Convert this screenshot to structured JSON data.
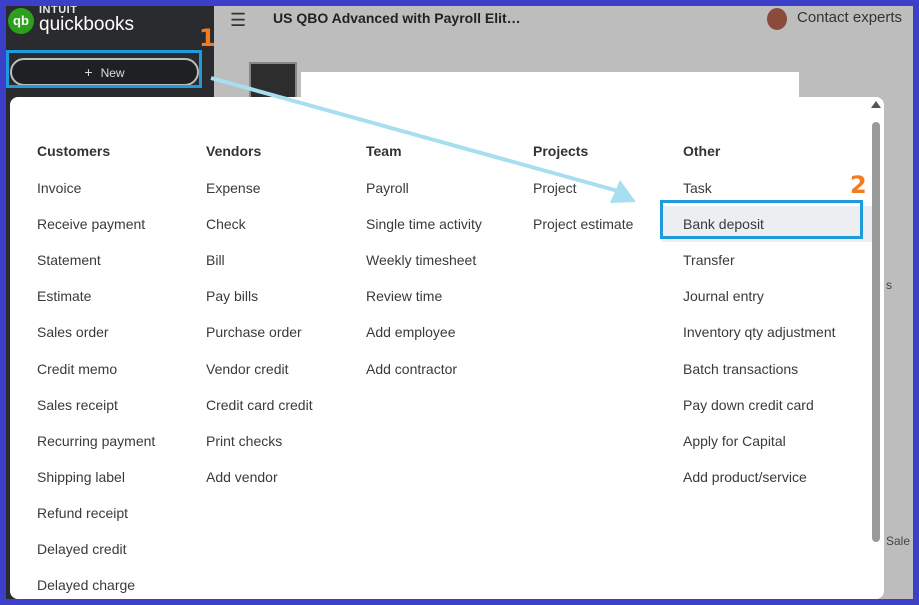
{
  "brand": {
    "top": "INTUIT",
    "name": "quickbooks",
    "logo_text": "qb"
  },
  "new_button": {
    "label": "New",
    "icon": "plus-icon"
  },
  "header": {
    "company": "US QBO Advanced with Payroll Elit…",
    "contact": "Contact experts",
    "menu_icon": "hamburger-icon"
  },
  "annotations": {
    "step1": "1",
    "step2": "2",
    "highlight_color": "#1d9bdc",
    "number_color": "#f47c20",
    "arrow_color": "#a8dff0"
  },
  "background": {
    "frag_s": "s",
    "frag_sale": "Sale"
  },
  "menu": {
    "columns": [
      {
        "title": "Customers",
        "items": [
          "Invoice",
          "Receive payment",
          "Statement",
          "Estimate",
          "Sales order",
          "Credit memo",
          "Sales receipt",
          "Recurring payment",
          "Shipping label",
          "Refund receipt",
          "Delayed credit",
          "Delayed charge"
        ]
      },
      {
        "title": "Vendors",
        "items": [
          "Expense",
          "Check",
          "Bill",
          "Pay bills",
          "Purchase order",
          "Vendor credit",
          "Credit card credit",
          "Print checks",
          "Add vendor"
        ]
      },
      {
        "title": "Team",
        "items": [
          "Payroll",
          "Single time activity",
          "Weekly timesheet",
          "Review time",
          "Add employee",
          "Add contractor"
        ]
      },
      {
        "title": "Projects",
        "items": [
          "Project",
          "Project estimate"
        ]
      },
      {
        "title": "Other",
        "items": [
          "Task",
          "Bank deposit",
          "Transfer",
          "Journal entry",
          "Inventory qty adjustment",
          "Batch transactions",
          "Pay down credit card",
          "Apply for Capital",
          "Add product/service"
        ]
      }
    ],
    "highlighted_item": "Bank deposit"
  }
}
